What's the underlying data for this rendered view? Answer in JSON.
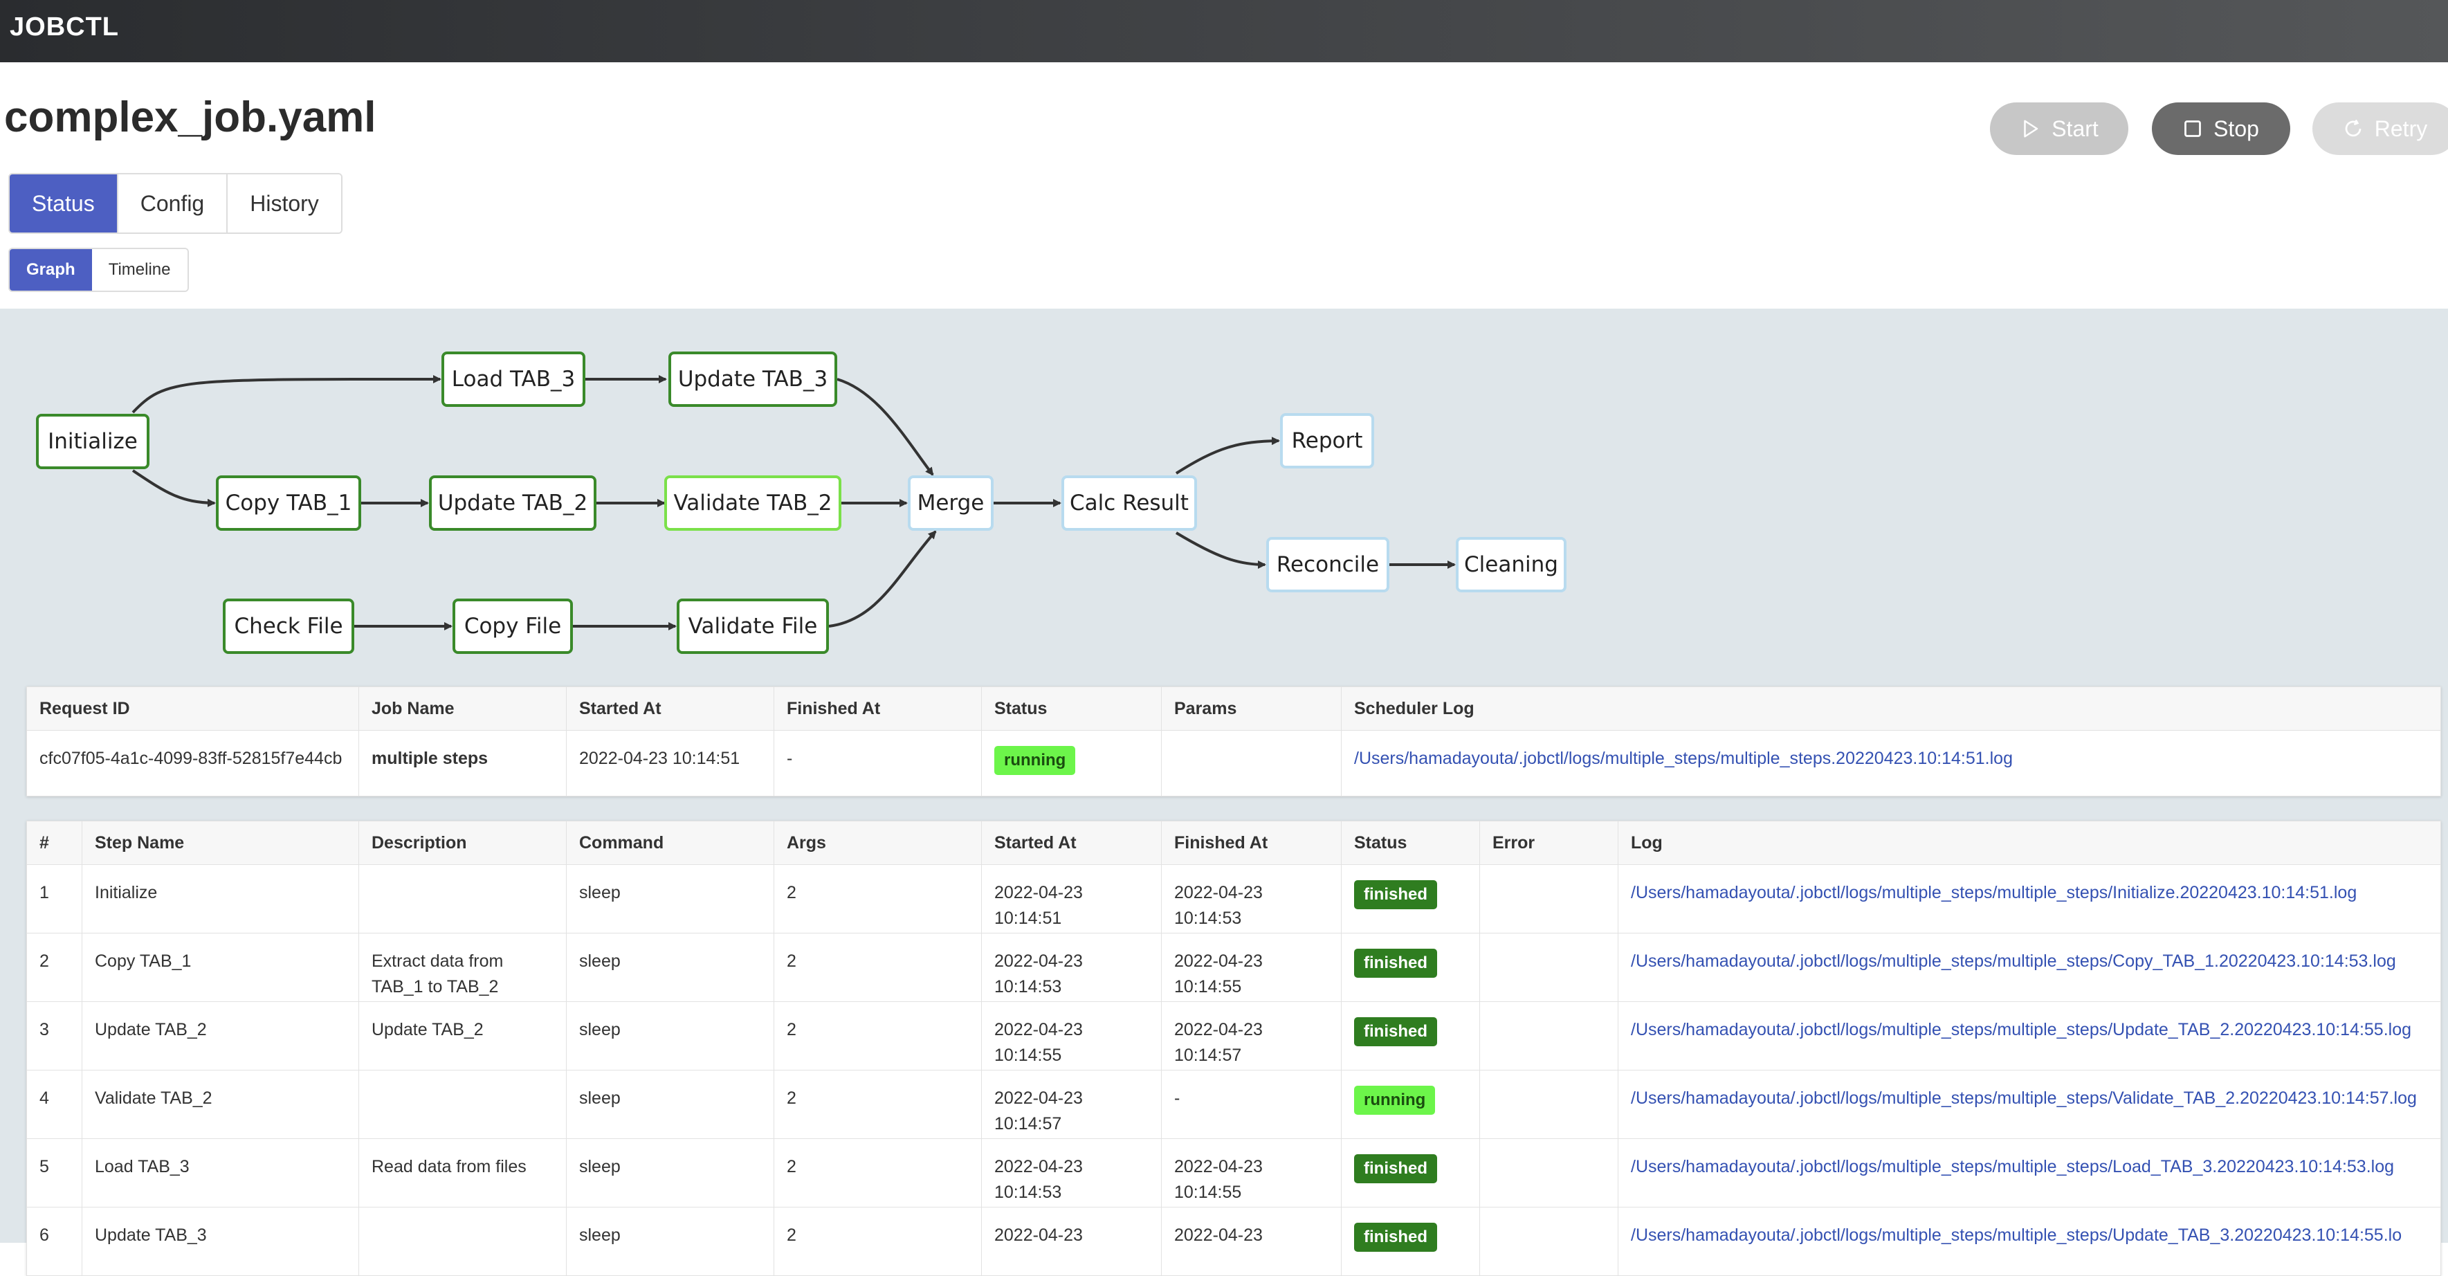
{
  "app": {
    "brand": "JOBCTL"
  },
  "page": {
    "title": "complex_job.yaml"
  },
  "actions": {
    "start": "Start",
    "stop": "Stop",
    "retry": "Retry"
  },
  "tabs": [
    "Status",
    "Config",
    "History"
  ],
  "subtabs": [
    "Graph",
    "Timeline"
  ],
  "graph": {
    "nodes": {
      "initialize": {
        "label": "Initialize",
        "status": "finished"
      },
      "load_tab3": {
        "label": "Load TAB_3",
        "status": "finished"
      },
      "update_tab3": {
        "label": "Update TAB_3",
        "status": "finished"
      },
      "copy_tab1": {
        "label": "Copy TAB_1",
        "status": "finished"
      },
      "update_tab2": {
        "label": "Update TAB_2",
        "status": "finished"
      },
      "validate_tab2": {
        "label": "Validate TAB_2",
        "status": "running"
      },
      "merge": {
        "label": "Merge",
        "status": "pending"
      },
      "calc_result": {
        "label": "Calc Result",
        "status": "pending"
      },
      "report": {
        "label": "Report",
        "status": "pending"
      },
      "reconcile": {
        "label": "Reconcile",
        "status": "pending"
      },
      "cleaning": {
        "label": "Cleaning",
        "status": "pending"
      },
      "check_file": {
        "label": "Check File",
        "status": "finished"
      },
      "copy_file": {
        "label": "Copy File",
        "status": "finished"
      },
      "validate_file": {
        "label": "Validate File",
        "status": "finished"
      }
    },
    "colors": {
      "finished": "#3a8a2a",
      "running": "#7be04a",
      "pending": "#b8dbef",
      "edge": "#333333"
    }
  },
  "request_table": {
    "headers": [
      "Request ID",
      "Job Name",
      "Started At",
      "Finished At",
      "Status",
      "Params",
      "Scheduler Log"
    ],
    "row": {
      "request_id": "cfc07f05-4a1c-4099-83ff-52815f7e44cb",
      "job_name": "multiple steps",
      "started_at": "2022-04-23 10:14:51",
      "finished_at": "-",
      "status": "running",
      "params": "",
      "scheduler_log": "/Users/hamadayouta/.jobctl/logs/multiple_steps/multiple_steps.20220423.10:14:51.log"
    }
  },
  "steps_table": {
    "headers": [
      "#",
      "Step Name",
      "Description",
      "Command",
      "Args",
      "Started At",
      "Finished At",
      "Status",
      "Error",
      "Log"
    ],
    "rows": [
      {
        "num": "1",
        "name": "Initialize",
        "description": "",
        "command": "sleep",
        "args": "2",
        "started": "2022-04-23 10:14:51",
        "finished": "2022-04-23 10:14:53",
        "status": "finished",
        "error": "",
        "log": "/Users/hamadayouta/.jobctl/logs/multiple_steps/multiple_steps/Initialize.20220423.10:14:51.log"
      },
      {
        "num": "2",
        "name": "Copy TAB_1",
        "description": "Extract data from TAB_1 to TAB_2",
        "command": "sleep",
        "args": "2",
        "started": "2022-04-23 10:14:53",
        "finished": "2022-04-23 10:14:55",
        "status": "finished",
        "error": "",
        "log": "/Users/hamadayouta/.jobctl/logs/multiple_steps/multiple_steps/Copy_TAB_1.20220423.10:14:53.log"
      },
      {
        "num": "3",
        "name": "Update TAB_2",
        "description": "Update TAB_2",
        "command": "sleep",
        "args": "2",
        "started": "2022-04-23 10:14:55",
        "finished": "2022-04-23 10:14:57",
        "status": "finished",
        "error": "",
        "log": "/Users/hamadayouta/.jobctl/logs/multiple_steps/multiple_steps/Update_TAB_2.20220423.10:14:55.log"
      },
      {
        "num": "4",
        "name": "Validate TAB_2",
        "description": "",
        "command": "sleep",
        "args": "2",
        "started": "2022-04-23 10:14:57",
        "finished": "-",
        "status": "running",
        "error": "",
        "log": "/Users/hamadayouta/.jobctl/logs/multiple_steps/multiple_steps/Validate_TAB_2.20220423.10:14:57.log"
      },
      {
        "num": "5",
        "name": "Load TAB_3",
        "description": "Read data from files",
        "command": "sleep",
        "args": "2",
        "started": "2022-04-23 10:14:53",
        "finished": "2022-04-23 10:14:55",
        "status": "finished",
        "error": "",
        "log": "/Users/hamadayouta/.jobctl/logs/multiple_steps/multiple_steps/Load_TAB_3.20220423.10:14:53.log"
      },
      {
        "num": "6",
        "name": "Update TAB_3",
        "description": "",
        "command": "sleep",
        "args": "2",
        "started": "2022-04-23",
        "finished": "2022-04-23",
        "status": "finished",
        "error": "",
        "log": "/Users/hamadayouta/.jobctl/logs/multiple_steps/multiple_steps/Update_TAB_3.20220423.10:14:55.lo"
      }
    ]
  }
}
